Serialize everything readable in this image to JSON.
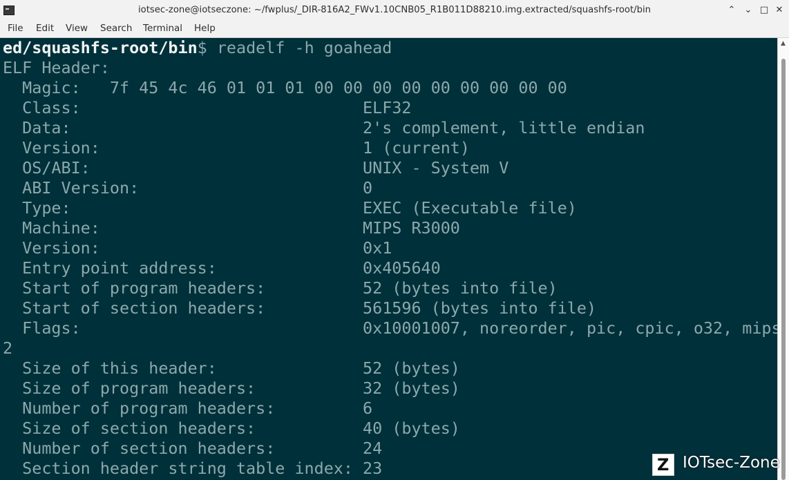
{
  "window": {
    "title": "iotsec-zone@iotseczone: ~/fwplus/_DIR-816A2_FWv1.10CNB05_R1B011D88210.img.extracted/squashfs-root/bin",
    "minimize_glyph": "⌃",
    "restore_glyph": "⌄",
    "maximize_glyph": "□",
    "close_glyph": "✕"
  },
  "menu": {
    "file": "File",
    "edit": "Edit",
    "view": "View",
    "search": "Search",
    "terminal": "Terminal",
    "help": "Help"
  },
  "terminal": {
    "prompt_path": "ed/squashfs-root/bin",
    "prompt_suffix": "$ ",
    "command": "readelf -h goahead",
    "lines": [
      "ELF Header:",
      "  Magic:   7f 45 4c 46 01 01 01 00 00 00 00 00 00 00 00 00",
      "  Class:                             ELF32",
      "  Data:                              2's complement, little endian",
      "  Version:                           1 (current)",
      "  OS/ABI:                            UNIX - System V",
      "  ABI Version:                       0",
      "  Type:                              EXEC (Executable file)",
      "  Machine:                           MIPS R3000",
      "  Version:                           0x1",
      "  Entry point address:               0x405640",
      "  Start of program headers:          52 (bytes into file)",
      "  Start of section headers:          561596 (bytes into file)",
      "  Flags:                             0x10001007, noreorder, pic, cpic, o32, mips",
      "2",
      "  Size of this header:               52 (bytes)",
      "  Size of program headers:           32 (bytes)",
      "  Number of program headers:         6",
      "  Size of section headers:           40 (bytes)",
      "  Number of section headers:         24",
      "  Section header string table index: 23"
    ]
  },
  "watermark": {
    "logo_letter": "Z",
    "text": "IOTsec-Zone"
  },
  "colors": {
    "terminal_bg": "#00303a",
    "terminal_fg": "#8ba9ac",
    "prompt_fg": "#f0f4f4"
  }
}
